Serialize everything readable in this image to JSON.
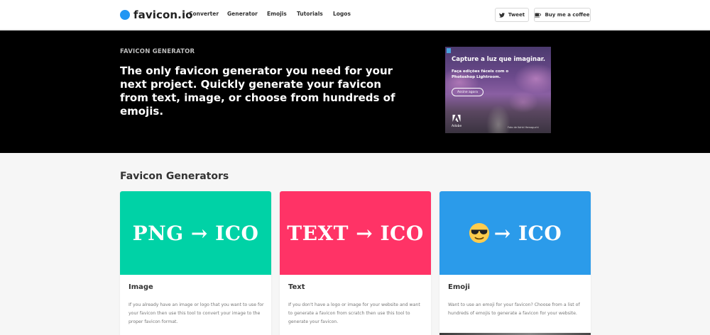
{
  "nav": {
    "logo_text": "favicon.io",
    "links": [
      "Converter",
      "Generator",
      "Emojis",
      "Tutorials",
      "Logos"
    ],
    "tweet_label": "Tweet",
    "coffee_label": "Buy me a coffee",
    "brand_color": "#2196f3"
  },
  "hero": {
    "eyebrow": "FAVICON GENERATOR",
    "title": "The only favicon generator you need for your next project. Quickly generate your favicon from text, image, or choose from hundreds of emojis.",
    "background": "#000000"
  },
  "ad": {
    "headline": "Capture a luz que imaginar.",
    "subtext": "Faça edições fáceis com o Photoshop Lightroom.",
    "button_label": "Assine agora",
    "brand": "Adobe",
    "credit": "Foto de Kohki Yamaguchi"
  },
  "section": {
    "title": "Favicon Generators"
  },
  "cards": [
    {
      "banner": "PNG → ICO",
      "title": "Image",
      "description": "If you already have an image or logo that you want to use for your favicon then use this tool to convert your image to the proper favicon format.",
      "color": "#00d2a6"
    },
    {
      "banner": "TEXT → ICO",
      "title": "Text",
      "description": "If you don't have a logo or image for your website and want to generate a favicon from scratch then use this tool to generate your favicon.",
      "color": "#ff3366"
    },
    {
      "banner": "→ ICO",
      "title": "Emoji",
      "description": "Want to use an emoji for your favicon? Choose from a list of hundreds of emojis to generate a favicon for your website.",
      "color": "#2b9bea"
    }
  ]
}
